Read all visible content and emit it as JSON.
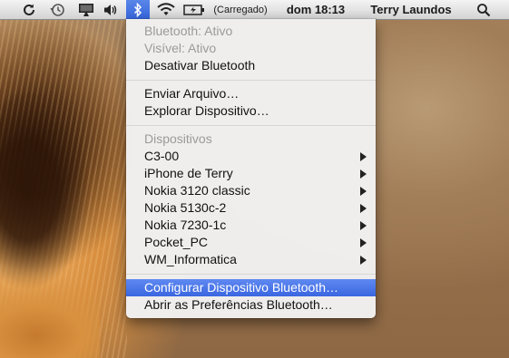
{
  "menubar": {
    "icons": [
      "sync-icon",
      "time-machine-icon",
      "display-icon",
      "volume-icon",
      "bluetooth-icon",
      "wifi-icon",
      "battery-icon"
    ],
    "battery_status": "(Carregado)",
    "clock": "dom 18:13",
    "user": "Terry Laundos",
    "search_icon": "spotlight-search-icon"
  },
  "bluetooth_menu": {
    "status_bluetooth": "Bluetooth: Ativo",
    "status_visible": "Visível: Ativo",
    "toggle_off": "Desativar Bluetooth",
    "send_file": "Enviar Arquivo…",
    "browse_device": "Explorar Dispositivo…",
    "devices_header": "Dispositivos",
    "devices": [
      "C3-00",
      "iPhone de Terry",
      "Nokia 3120 classic",
      "Nokia 5130c-2",
      "Nokia 7230-1c",
      "Pocket_PC",
      "WM_Informatica"
    ],
    "setup_device": "Configurar Dispositivo Bluetooth…",
    "open_prefs": "Abrir as Preferências Bluetooth…"
  },
  "colors": {
    "selection": "#3a66e0",
    "bluetooth_highlight": "#3565dc"
  }
}
